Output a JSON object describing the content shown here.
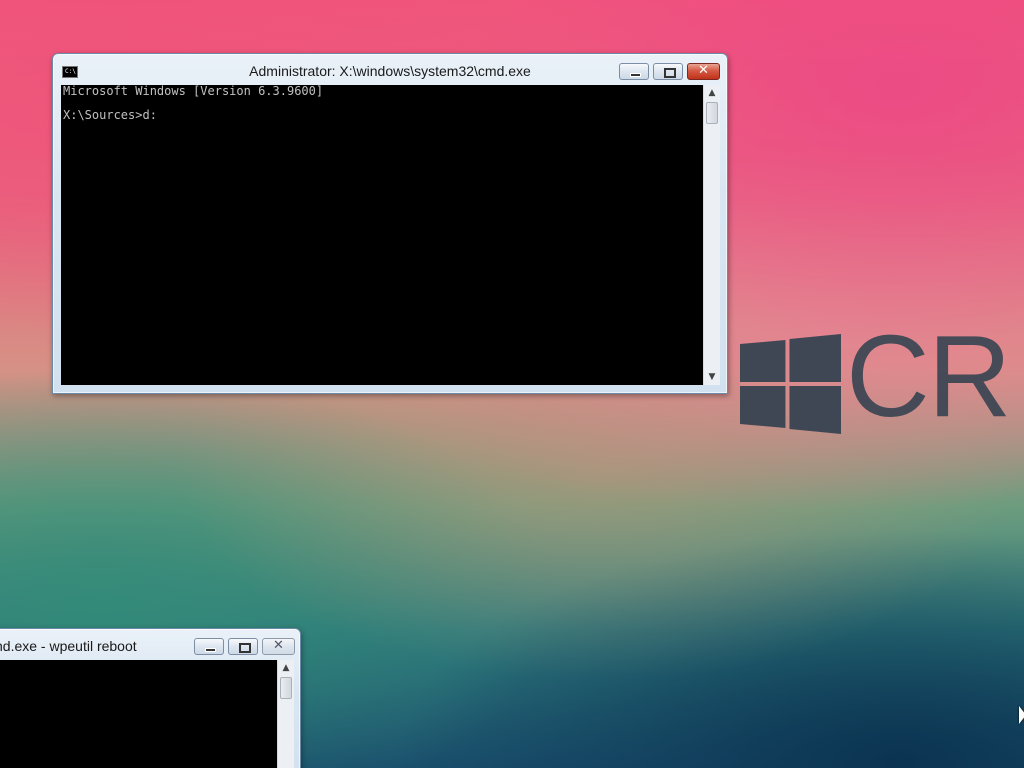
{
  "desktop": {
    "logo_text": "CR",
    "logo_color": "#3f4755"
  },
  "main_window": {
    "title": "Administrator: X:\\windows\\system32\\cmd.exe",
    "icon": "cmd-console-icon",
    "icon_text": "C:\\",
    "console_lines": [
      "Microsoft Windows [Version 6.3.9600]",
      "",
      "X:\\Sources>d:"
    ],
    "controls": {
      "minimize": "minimize",
      "maximize": "maximize",
      "close": "close"
    },
    "close_glyph": "✕",
    "console_text_color": "#c0c0c0",
    "console_bg": "#000000"
  },
  "second_window": {
    "title": "nd.exe - wpeutil  reboot",
    "close_glyph": "✕"
  },
  "scrollbar": {
    "up_arrow": "▲",
    "down_arrow": "▼"
  }
}
